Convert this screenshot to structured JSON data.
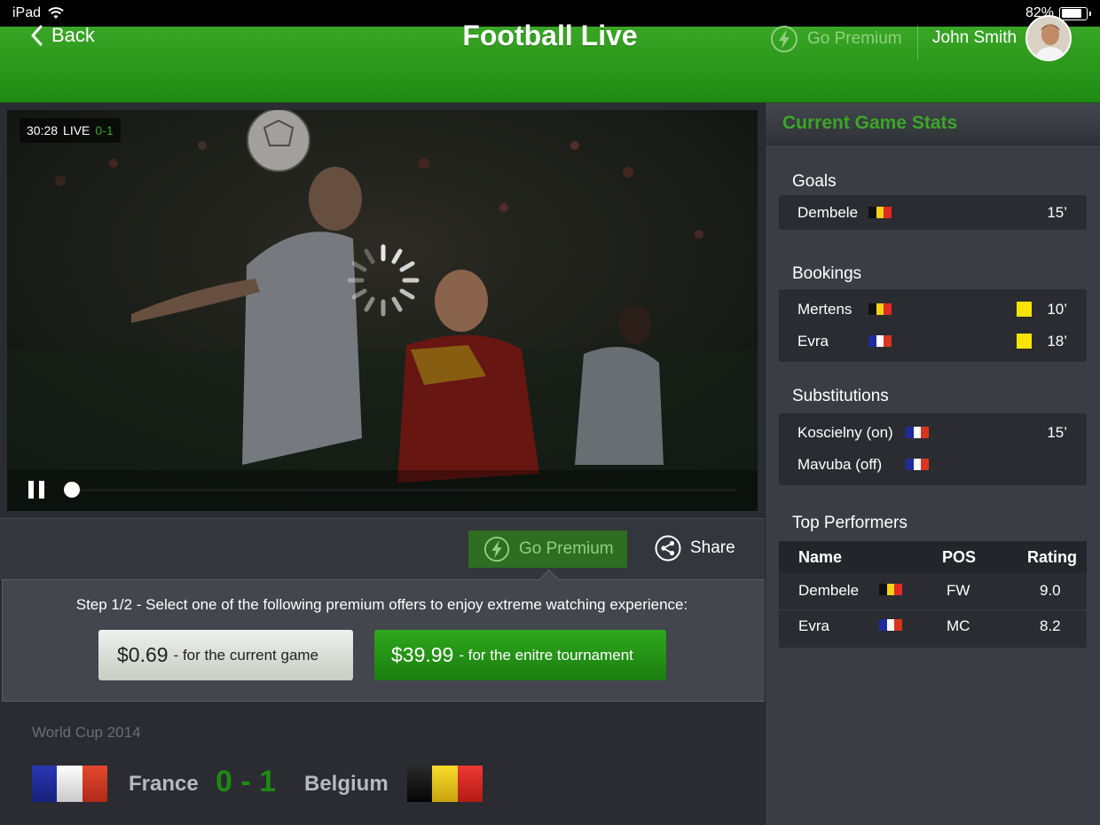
{
  "status_bar": {
    "device": "iPad",
    "battery": "82%",
    "battery_level": 0.82
  },
  "header": {
    "back_label": "Back",
    "title": "Football Live",
    "premium_label": "Go Premium",
    "user_name": "John Smith"
  },
  "video": {
    "time": "30:28",
    "live_label": "LIVE",
    "score": "0-1",
    "progress": 0.0
  },
  "actions": {
    "premium_label": "Go Premium",
    "share_label": "Share"
  },
  "premium_offer": {
    "step_text": "Step 1/2 - Select one of the following premium offers to enjoy extreme watching experience:",
    "offers": [
      {
        "price": "$0.69",
        "desc": "- for the current  game"
      },
      {
        "price": "$39.99",
        "desc": "- for the enitre tournament"
      }
    ]
  },
  "match": {
    "competition": "World Cup 2014",
    "home_team": "France",
    "away_team": "Belgium",
    "score": "0 - 1"
  },
  "stats": {
    "title": "Current Game Stats",
    "goals": {
      "title": "Goals",
      "items": [
        {
          "name": "Dembele",
          "team": "Belgium",
          "minute": "15’"
        }
      ]
    },
    "bookings": {
      "title": "Bookings",
      "items": [
        {
          "name": "Mertens",
          "team": "Belgium",
          "card": "yellow",
          "minute": "10’"
        },
        {
          "name": "Evra",
          "team": "France",
          "card": "yellow",
          "minute": "18’"
        }
      ]
    },
    "substitutions": {
      "title": "Substitutions",
      "items": [
        {
          "name": "Koscielny (on)",
          "team": "France",
          "minute": "15’"
        },
        {
          "name": "Mavuba (off)",
          "team": "France",
          "minute": ""
        }
      ]
    },
    "top_performers": {
      "title": "Top Performers",
      "columns": [
        "Name",
        "POS",
        "Rating"
      ],
      "rows": [
        {
          "name": "Dembele",
          "team": "Belgium",
          "pos": "FW",
          "rating": "9.0"
        },
        {
          "name": "Evra",
          "team": "France",
          "pos": "MC",
          "rating": "8.2"
        }
      ]
    }
  },
  "colors": {
    "brand_green": "#1f8a12",
    "accent_green": "#3aa626",
    "card_yellow": "#f6e500",
    "france_flag": [
      "#1f2a9e",
      "#ffffff",
      "#d8361f"
    ],
    "belgium_flag": [
      "#111111",
      "#f2d316",
      "#e12a26"
    ]
  }
}
